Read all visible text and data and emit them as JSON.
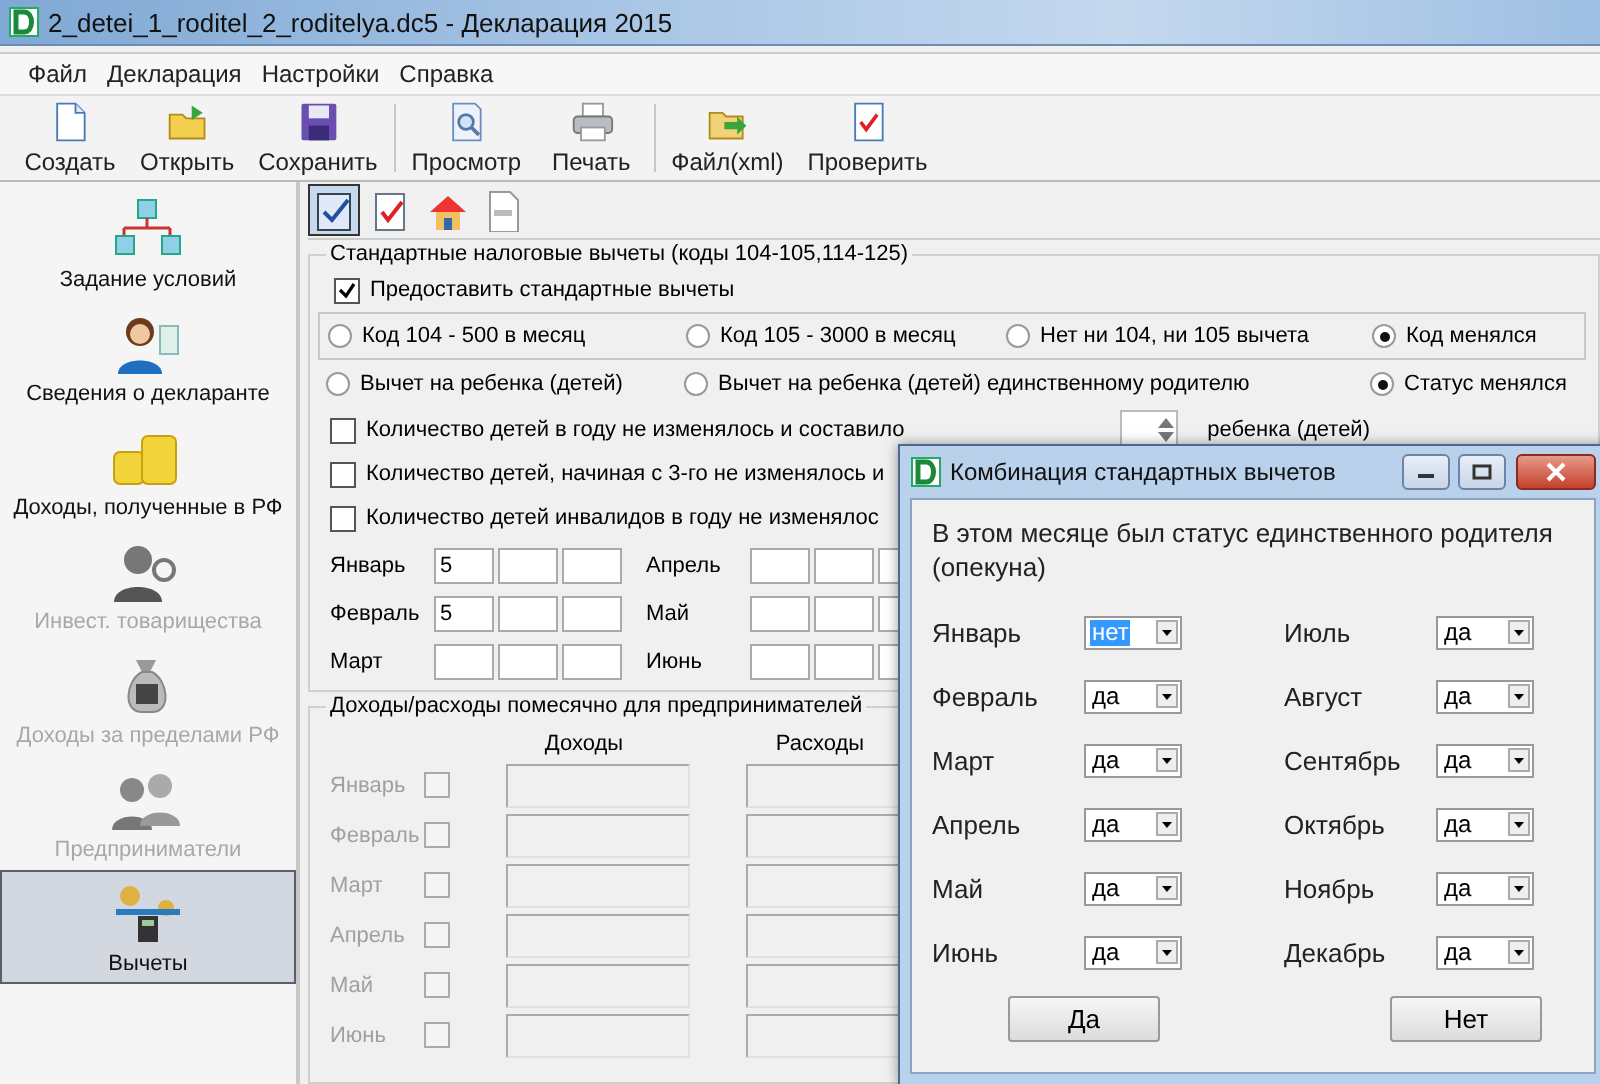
{
  "window": {
    "title": "2_detei_1_roditel_2_roditelya.dc5 - Декларация 2015"
  },
  "menu": [
    "Файл",
    "Декларация",
    "Настройки",
    "Справка"
  ],
  "toolbar": [
    {
      "label": "Создать",
      "kind": "new"
    },
    {
      "label": "Открыть",
      "kind": "open"
    },
    {
      "label": "Сохранить",
      "kind": "save"
    },
    {
      "label": "Просмотр",
      "kind": "preview"
    },
    {
      "label": "Печать",
      "kind": "print"
    },
    {
      "label": "Файл(xml)",
      "kind": "export"
    },
    {
      "label": "Проверить",
      "kind": "check"
    }
  ],
  "sidebar": {
    "items": [
      {
        "label": "Задание условий",
        "kind": "conditions",
        "selected": false,
        "disabled": false
      },
      {
        "label": "Сведения о декларанте",
        "kind": "person",
        "selected": false,
        "disabled": false
      },
      {
        "label": "Доходы, полученные в РФ",
        "kind": "coins",
        "selected": false,
        "disabled": false
      },
      {
        "label": "Инвест. товарищества",
        "kind": "investor",
        "selected": false,
        "disabled": true
      },
      {
        "label": "Доходы за пределами РФ",
        "kind": "moneybag",
        "selected": false,
        "disabled": true
      },
      {
        "label": "Предприниматели",
        "kind": "business",
        "selected": false,
        "disabled": true
      },
      {
        "label": "Вычеты",
        "kind": "deductions",
        "selected": true,
        "disabled": false
      }
    ]
  },
  "page_tabs": [
    {
      "kind": "standard",
      "selected": true
    },
    {
      "kind": "social",
      "selected": false
    },
    {
      "kind": "property",
      "selected": false
    },
    {
      "kind": "document",
      "selected": false
    }
  ],
  "standard_deductions": {
    "title": "Стандартные налоговые вычеты (коды 104-105,114-125)",
    "provide": {
      "label": "Предоставить стандартные вычеты",
      "checked": true
    },
    "code_options": [
      {
        "label": "Код 104 - 500 в месяц",
        "selected": false
      },
      {
        "label": "Код 105 - 3000 в месяц",
        "selected": false
      },
      {
        "label": "Нет ни 104, ни 105 вычета",
        "selected": false
      },
      {
        "label": "Код менялся",
        "selected": true
      }
    ],
    "recipient_options": [
      {
        "label": "Вычет на ребенка (детей)",
        "selected": false
      },
      {
        "label": "Вычет на ребенка (детей) единственному родителю",
        "selected": false
      },
      {
        "label": "Статус менялся",
        "selected": true
      }
    ],
    "count_options": [
      {
        "label": "Количество детей в году не изменялось и составило",
        "checked": false,
        "suffix": "ребенка (детей)"
      },
      {
        "label": "Количество детей, начиная с 3-го не изменялось и",
        "checked": false
      },
      {
        "label": "Количество детей инвалидов в году не изменялос",
        "checked": false
      }
    ],
    "months": [
      {
        "label": "Январь",
        "value": "5"
      },
      {
        "label": "Февраль",
        "value": "5"
      },
      {
        "label": "Март"
      },
      {
        "label": "Апрель"
      },
      {
        "label": "Май"
      },
      {
        "label": "Июнь"
      }
    ]
  },
  "entrepreneur": {
    "title": "Доходы/расходы помесячно для предпринимателей",
    "disabled": true,
    "columns": [
      "Доходы",
      "Расходы"
    ],
    "months": [
      {
        "label": "Январь",
        "checked": false
      },
      {
        "label": "Февраль",
        "checked": false
      },
      {
        "label": "Март",
        "checked": false
      },
      {
        "label": "Апрель",
        "checked": false
      },
      {
        "label": "Май",
        "checked": false
      },
      {
        "label": "Июнь",
        "checked": false
      }
    ]
  },
  "dialog": {
    "title": "Комбинация стандартных вычетов",
    "prompt": "В этом месяце был статус единственного родителя (опекуна)",
    "months": [
      {
        "label": "Январь",
        "value": "нет",
        "selected": true
      },
      {
        "label": "Февраль",
        "value": "да",
        "selected": false
      },
      {
        "label": "Март",
        "value": "да",
        "selected": false
      },
      {
        "label": "Апрель",
        "value": "да",
        "selected": false
      },
      {
        "label": "Май",
        "value": "да",
        "selected": false
      },
      {
        "label": "Июнь",
        "value": "да",
        "selected": false
      },
      {
        "label": "Июль",
        "value": "да",
        "selected": false
      },
      {
        "label": "Август",
        "value": "да",
        "selected": false
      },
      {
        "label": "Сентябрь",
        "value": "да",
        "selected": false
      },
      {
        "label": "Октябрь",
        "value": "да",
        "selected": false
      },
      {
        "label": "Ноябрь",
        "value": "да",
        "selected": false
      },
      {
        "label": "Декабрь",
        "value": "да",
        "selected": false
      }
    ],
    "buttons": [
      "Да",
      "Нет"
    ]
  }
}
